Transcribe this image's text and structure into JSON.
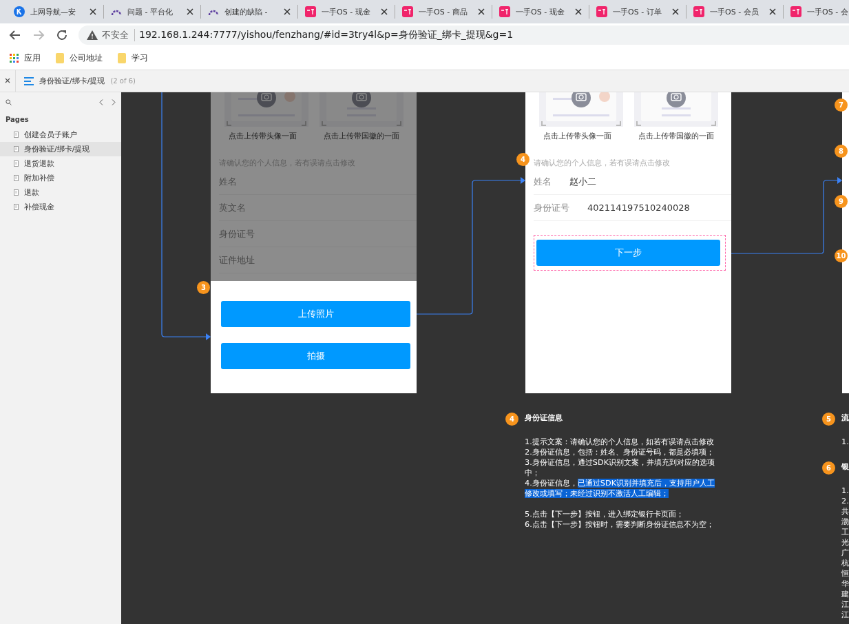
{
  "browser": {
    "tabs": [
      {
        "title": "上网导航—安"
      },
      {
        "title": "问题 - 平台化"
      },
      {
        "title": "创建的缺陷 -"
      },
      {
        "title": "一手OS - 现金"
      },
      {
        "title": "一手OS - 商品"
      },
      {
        "title": "一手OS - 现金"
      },
      {
        "title": "一手OS - 订单"
      },
      {
        "title": "一手OS - 会员"
      },
      {
        "title": "一手OS - 会"
      }
    ],
    "security": "不安全",
    "url": "192.168.1.244:7777/yishou/fenzhang/#id=3try4l&p=身份验证_绑卡_提现&g=1",
    "bookmarks": [
      {
        "label": "应用",
        "kind": "apps"
      },
      {
        "label": "公司地址",
        "kind": "folder"
      },
      {
        "label": "学习",
        "kind": "folder"
      }
    ]
  },
  "viewer": {
    "page_title": "身份验证/绑卡/提现",
    "page_count": "(2 of 6)"
  },
  "sidebar": {
    "heading": "Pages",
    "items": [
      {
        "label": "创建会员子账户",
        "selected": false
      },
      {
        "label": "身份验证/绑卡/提现",
        "selected": true
      },
      {
        "label": "退货退款",
        "selected": false
      },
      {
        "label": "附加补偿",
        "selected": false
      },
      {
        "label": "退款",
        "selected": false
      },
      {
        "label": "补偿现金",
        "selected": false
      }
    ]
  },
  "screens": [
    {
      "dimmed": true,
      "upload_labels": [
        "点击上传带头像一面",
        "点击上传带国徽的一面"
      ],
      "hint": "请确认您的个人信息，若有误请点击修改",
      "fields": [
        {
          "label": "姓名"
        },
        {
          "label": "英文名"
        },
        {
          "label": "身份证号"
        },
        {
          "label": "证件地址"
        }
      ],
      "sheet_badge": "3",
      "sheet_buttons": [
        "上传照片",
        "拍摄"
      ]
    },
    {
      "dimmed": false,
      "upload_labels": [
        "点击上传带头像一面",
        "点击上传带国徽的一面"
      ],
      "hint_badge": "4",
      "hint": "请确认您的个人信息，若有误请点击修改",
      "fields": [
        {
          "label": "姓名",
          "value": "赵小二"
        },
        {
          "label": "身份证号",
          "value": "402114197510240028"
        }
      ],
      "next_button": "下一步"
    }
  ],
  "side_badges": [
    "7",
    "8",
    "9",
    "10"
  ],
  "notes": [
    {
      "badge": "4",
      "title": "身份证信息",
      "paragraphs": [
        [
          {
            "text": "1.提示文案：请确认您的个人信息，如若有误请点击修改"
          },
          {
            "text": "2.身份证信息，包括：姓名、身份证号码，都是必填项；"
          },
          {
            "text": "3.身份证信息，通过SDK识别文案，并填充到对应的选项中；"
          },
          {
            "text": "4.身份证信息，",
            "highlight": "已通过SDK识别并填充后，支持用户人工修改或填写；未经过识别不激活人工编辑；"
          }
        ],
        [
          {
            "text": "5.点击【下一步】按钮，进入绑定银行卡页面；"
          },
          {
            "text": "6.点击【下一步】按钮时，需要判断身份证信息不为空；"
          }
        ]
      ]
    },
    {
      "badge": "5",
      "title": "流",
      "paragraphs": [
        [
          {
            "text": "1."
          }
        ]
      ]
    },
    {
      "badge": "6",
      "title": "银",
      "paragraphs": [
        [
          {
            "text": "1."
          },
          {
            "text": "2."
          },
          {
            "text": "共"
          },
          {
            "text": "渤"
          },
          {
            "text": "工"
          },
          {
            "text": "光"
          },
          {
            "text": "广"
          },
          {
            "text": "杭"
          },
          {
            "text": "恒"
          },
          {
            "text": "华"
          },
          {
            "text": "建"
          },
          {
            "text": "江"
          },
          {
            "text": "江"
          }
        ]
      ]
    }
  ]
}
